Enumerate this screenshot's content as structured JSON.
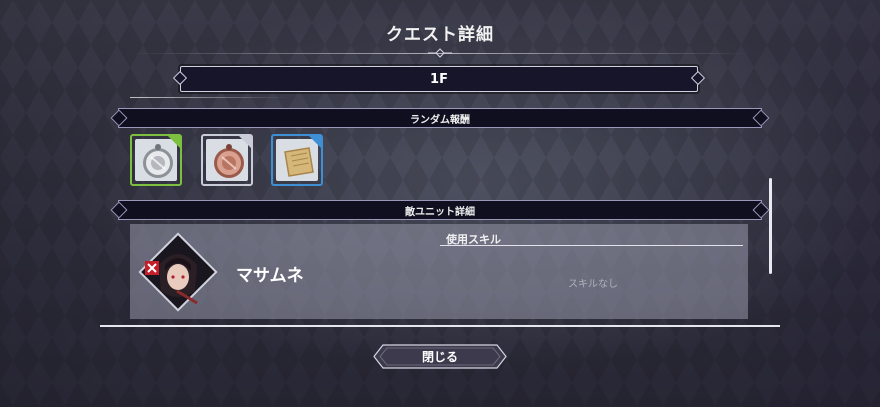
{
  "dialog": {
    "title": "クエスト詳細",
    "floor": "1F",
    "random_rewards_label": "ランダム報酬",
    "enemy_units_label": "敵ユニット詳細",
    "close_label": "閉じる"
  },
  "rewards": [
    {
      "name": "silver-medal-icon",
      "rarity_color": "#7dbf3e"
    },
    {
      "name": "bronze-medal-icon",
      "rarity_color": "#c7ccd6"
    },
    {
      "name": "scroll-icon",
      "rarity_color": "#3f8fd4"
    }
  ],
  "enemy": {
    "name": "マサムネ",
    "skills_label": "使用スキル",
    "skills_value": "スキルなし"
  }
}
